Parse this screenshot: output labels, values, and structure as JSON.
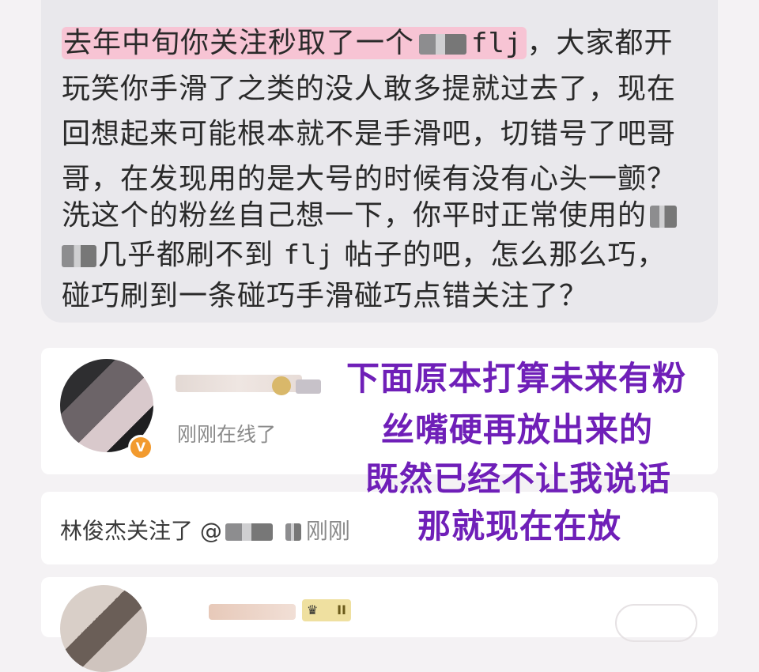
{
  "post": {
    "lines": [
      {
        "hl_text": "去年中旬你关注秒取了一个",
        "code": "flj",
        "rest": "，大家都开"
      },
      {
        "text": "玩笑你手滑了之类的没人敢多提就过去了，现在"
      },
      {
        "text": "回想起来可能根本就不是手滑吧，切错号了吧哥"
      },
      {
        "text": "哥，在发现用的是大号的时候有没有心头一颤？"
      },
      {
        "text": "洗这个的粉丝自己想一下，你平时正常使用的"
      },
      {
        "after_blur": "几乎都刷不到",
        "code": "flj",
        "rest": "帖子的吧，怎么那么巧，"
      },
      {
        "text": "碰巧刷到一条碰巧手滑碰巧点错关注了？"
      }
    ]
  },
  "profile1": {
    "status": "刚刚在线了",
    "badge": "V"
  },
  "follow_notice": {
    "prefix": "林俊杰关注了 @",
    "time": "刚刚"
  },
  "profile2": {
    "level_badge": "II"
  },
  "overlay": {
    "lines": [
      "下面原本打算未来有粉",
      "丝嘴硬再放出来的",
      "既然已经不让我说话",
      "那就现在在放"
    ],
    "color": "#6f1fb8"
  }
}
